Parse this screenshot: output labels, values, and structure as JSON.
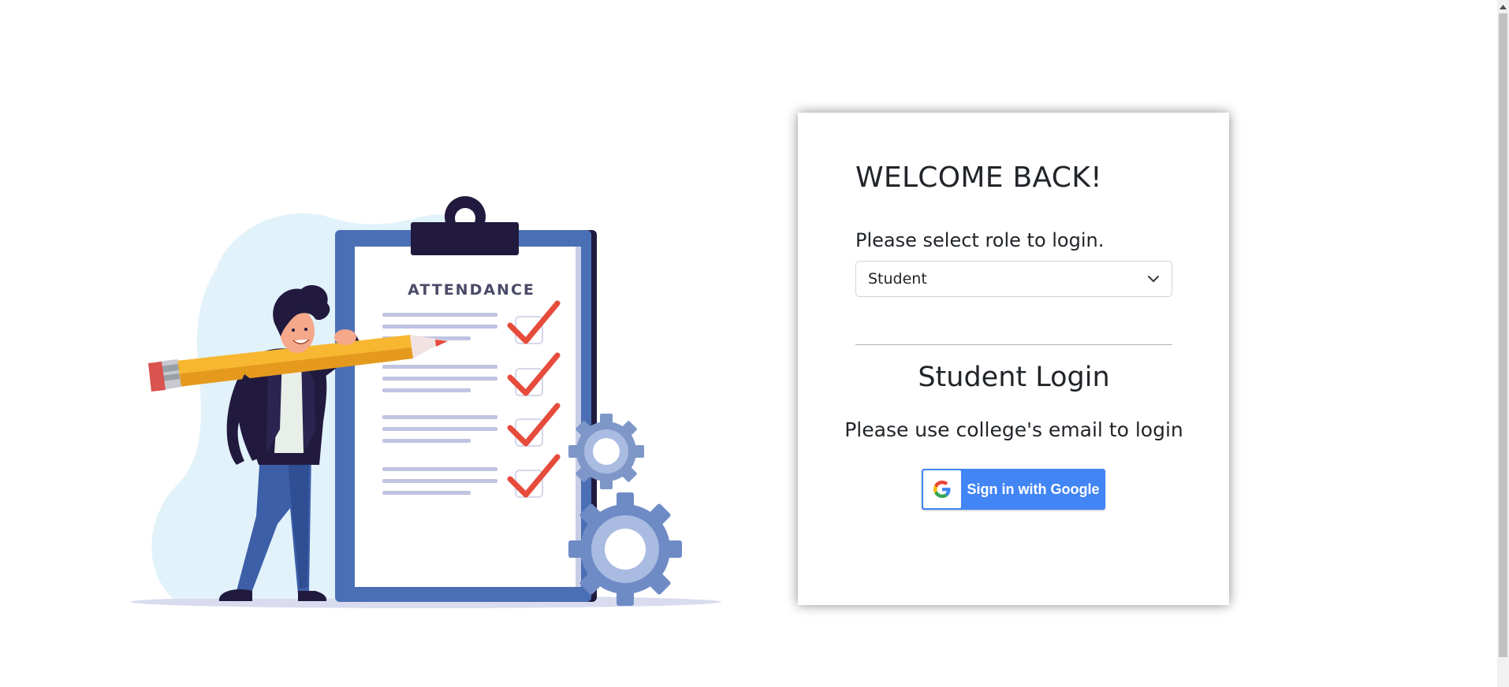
{
  "login_card": {
    "heading": "WELCOME BACK!",
    "role_prompt": "Please select role to login.",
    "role_select": {
      "selected": "Student"
    },
    "section_title": "Student Login",
    "email_hint": "Please use college's email to login",
    "google_button_label": "Sign in with Google"
  },
  "illustration": {
    "clipboard_title": "ATTENDANCE"
  },
  "colors": {
    "google_blue": "#4285f4",
    "check_red": "#e64b3c",
    "clipboard_blue": "#4a6fb5",
    "clip_navy": "#211a3e",
    "blob_light_blue": "#e2f2fb"
  },
  "icons": {
    "select_chevron": "chevron-down-icon",
    "google_logo": "google-logo-icon",
    "scroll_up": "scroll-up-arrow-icon"
  }
}
